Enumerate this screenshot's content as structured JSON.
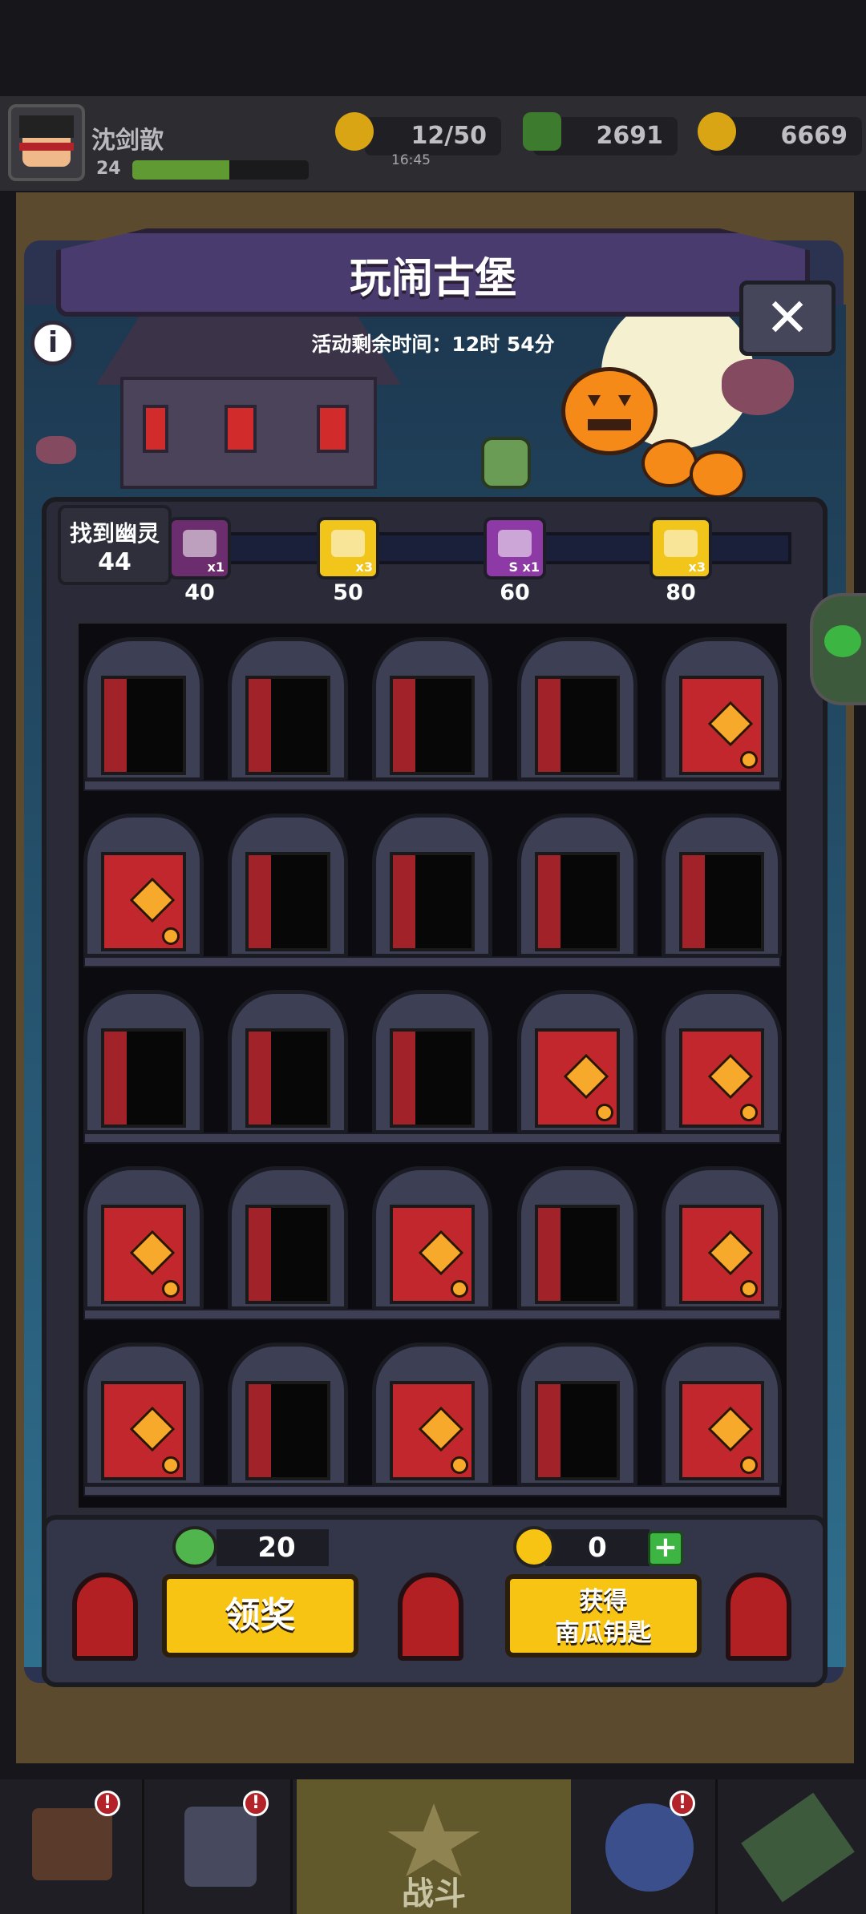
{
  "header": {
    "username": "沈剑歆",
    "level": "24",
    "xp_progress": 0.55,
    "energy": "12/50",
    "energy_timer": "16:45",
    "gems": "2691",
    "coins": "6669"
  },
  "event": {
    "title": "玩闹古堡",
    "timer_label": "活动剩余时间：12时 54分",
    "found_label": "找到幽灵",
    "found_count": "44",
    "progress_fraction": 0.07,
    "milestones": [
      {
        "value": "40",
        "reward_label": "x1",
        "icon": "weapon-icon",
        "color": "#6b2d6e"
      },
      {
        "value": "50",
        "reward_label": "x3",
        "icon": "silver-key-icon",
        "color": "#f2c51b"
      },
      {
        "value": "60",
        "reward_label": "S x1",
        "icon": "s-chest-icon",
        "color": "#8e3aa6"
      },
      {
        "value": "80",
        "reward_label": "x3",
        "icon": "silver-key-icon",
        "color": "#f2c51b"
      }
    ]
  },
  "grid": {
    "rows": [
      [
        "open",
        "open",
        "open",
        "open",
        "closed"
      ],
      [
        "closed",
        "open",
        "open",
        "open",
        "open"
      ],
      [
        "open",
        "open",
        "open",
        "closed",
        "closed"
      ],
      [
        "closed",
        "open",
        "closed",
        "open",
        "closed"
      ],
      [
        "closed",
        "open",
        "closed",
        "open",
        "closed"
      ]
    ]
  },
  "footer": {
    "candy_count": "20",
    "key_count": "0",
    "claim_label": "领奖",
    "get_key_line1": "获得",
    "get_key_line2": "南瓜钥匙"
  },
  "nav": {
    "battle_label": "战斗",
    "items": [
      "shop-icon",
      "badge-icon",
      "battle-icon",
      "orb-icon",
      "scroll-icon"
    ]
  },
  "colors": {
    "accent_yellow": "#f7c413",
    "door_red": "#c1272d",
    "panel": "#2c3350"
  }
}
